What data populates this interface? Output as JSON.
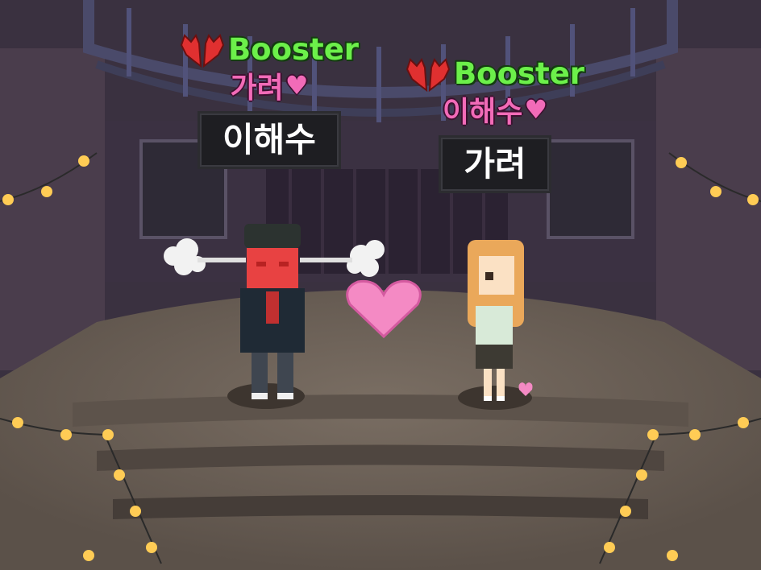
{
  "colors": {
    "booster": "#6cf04a",
    "partner": "#f26bb8",
    "nameplate_bg": "#1e1e22",
    "nameplate_text": "#ffffff",
    "stage": "#6d6259",
    "wall": "#3e3344",
    "light": "#ffcc55"
  },
  "players": [
    {
      "name": "이해수",
      "partner": "가려",
      "badge": "Booster",
      "badge_icon": "red-wings-icon",
      "partner_icon": "heart-icon",
      "status": "blushing"
    },
    {
      "name": "가려",
      "partner": "이해수",
      "badge": "Booster",
      "badge_icon": "red-wings-icon",
      "partner_icon": "heart-icon",
      "status": "shy"
    }
  ],
  "effects": {
    "center_icon": "big-heart-icon",
    "small_icon": "small-heart-icon"
  }
}
